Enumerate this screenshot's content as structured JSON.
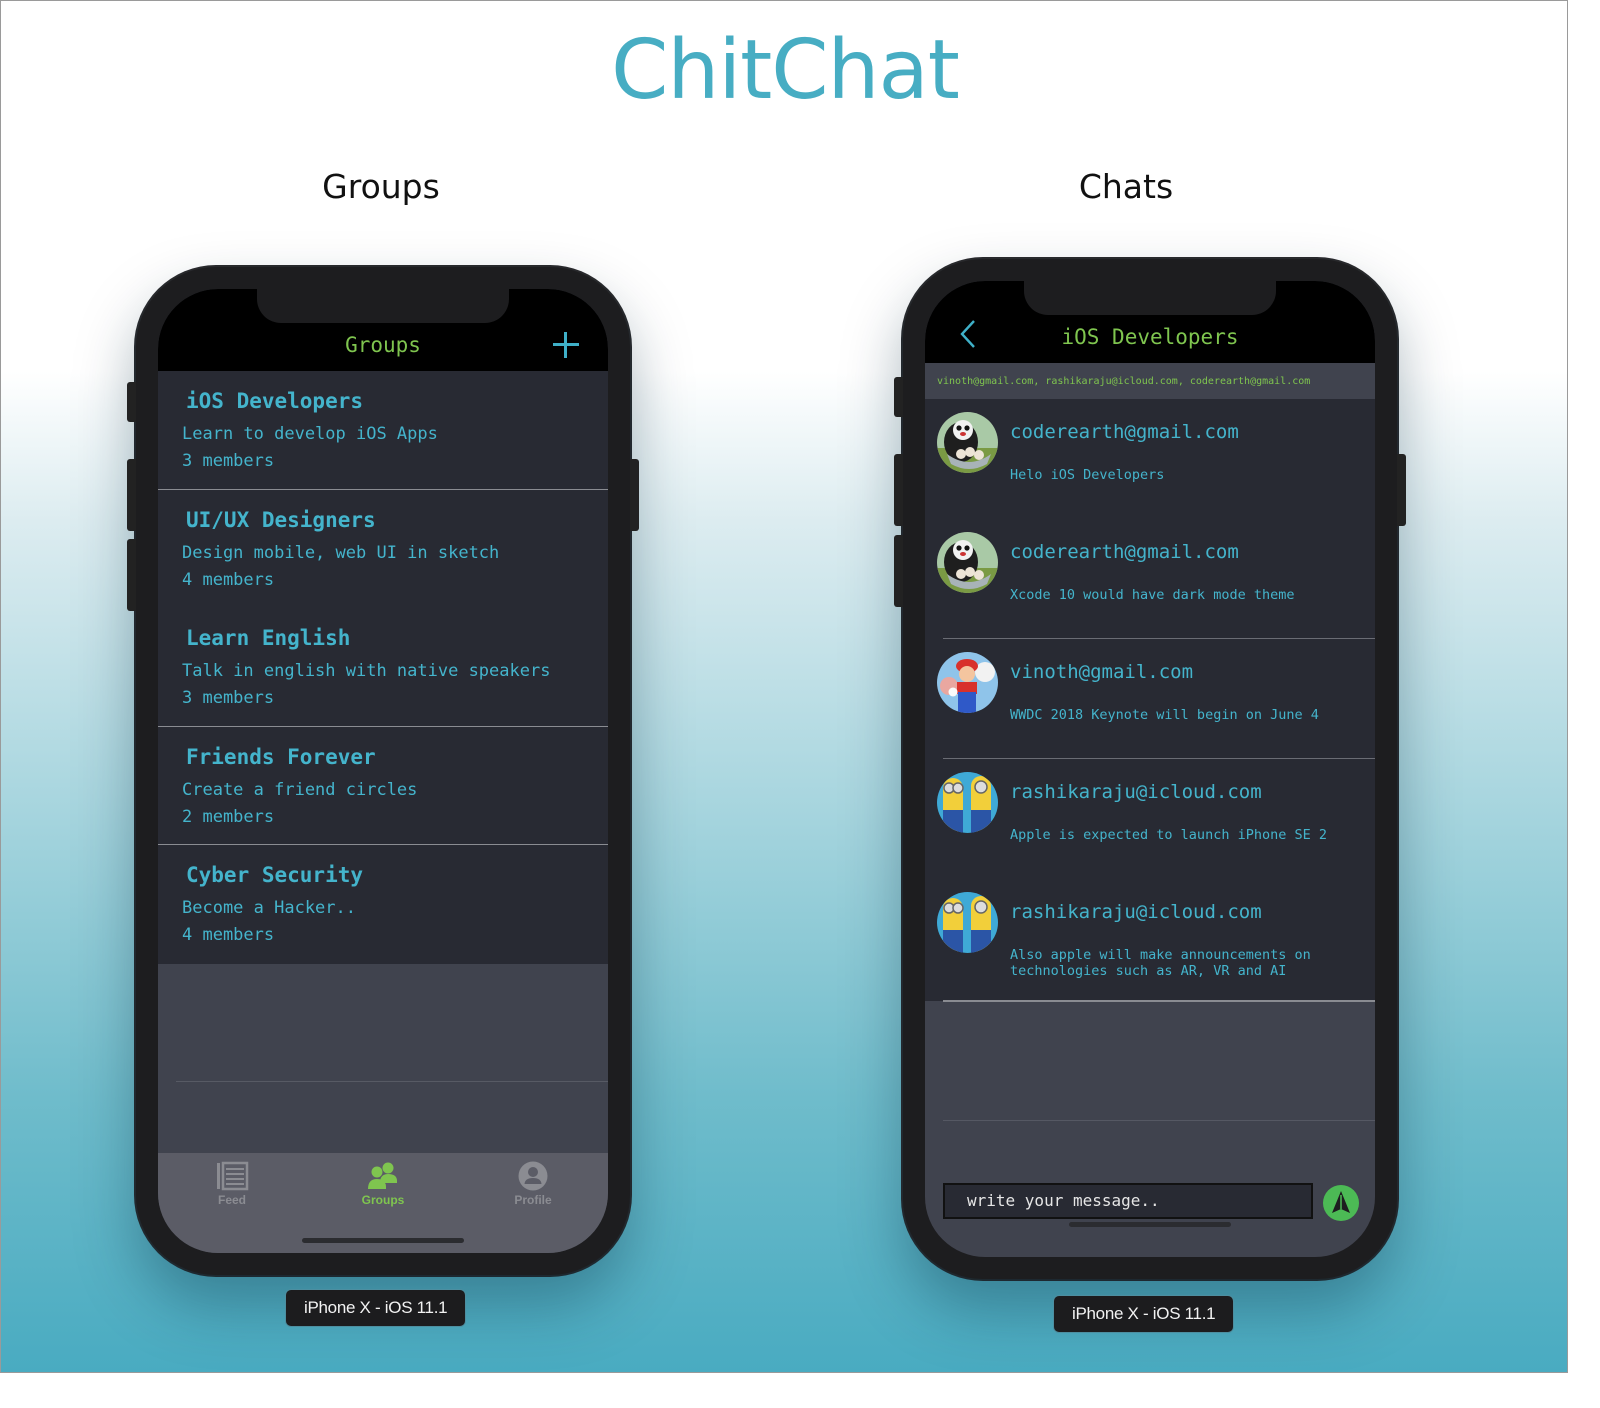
{
  "app_title": "ChitChat",
  "sections": {
    "groups_title": "Groups",
    "chats_title": "Chats"
  },
  "colors": {
    "brand": "#47adc3",
    "accent_green": "#7fc54f",
    "text_cyan": "#44b4cc",
    "send_button": "#4cba55"
  },
  "groups_screen": {
    "nav_title": "Groups",
    "add_icon": "plus-icon",
    "groups": [
      {
        "name": "iOS Developers",
        "description": "Learn to develop iOS Apps",
        "members": "3 members"
      },
      {
        "name": "UI/UX Designers",
        "description": "Design mobile, web UI in sketch",
        "members": "4 members"
      },
      {
        "name": "Learn English",
        "description": "Talk in english with native speakers",
        "members": "3 members"
      },
      {
        "name": "Friends Forever",
        "description": "Create a friend circles",
        "members": "2 members"
      },
      {
        "name": "Cyber Security",
        "description": "Become a Hacker..",
        "members": "4 members"
      }
    ],
    "tabs": [
      {
        "label": "Feed",
        "icon": "feed-icon",
        "active": false
      },
      {
        "label": "Groups",
        "icon": "groups-icon",
        "active": true
      },
      {
        "label": "Profile",
        "icon": "profile-icon",
        "active": false
      }
    ],
    "device_label": "iPhone X - iOS 11.1"
  },
  "chat_screen": {
    "nav_title": "iOS Developers",
    "back_icon": "chevron-left-icon",
    "members_line": "vinoth@gmail.com, rashikaraju@icloud.com, coderearth@gmail.com",
    "messages": [
      {
        "sender": "coderearth@gmail.com",
        "text": "Helo iOS Developers",
        "avatar": "panda-avatar"
      },
      {
        "sender": "coderearth@gmail.com",
        "text": "Xcode 10 would have dark mode theme",
        "avatar": "panda-avatar"
      },
      {
        "sender": "vinoth@gmail.com",
        "text": "WWDC 2018 Keynote will begin on June 4",
        "avatar": "mario-avatar"
      },
      {
        "sender": "rashikaraju@icloud.com",
        "text": "Apple is expected to launch iPhone SE 2",
        "avatar": "minions-avatar"
      },
      {
        "sender": "rashikaraju@icloud.com",
        "text": "Also apple will make announcements on technologies such as AR, VR and AI",
        "avatar": "minions-avatar"
      }
    ],
    "input_placeholder": "write your message..",
    "send_icon": "send-arrow-icon",
    "device_label": "iPhone X - iOS 11.1"
  }
}
